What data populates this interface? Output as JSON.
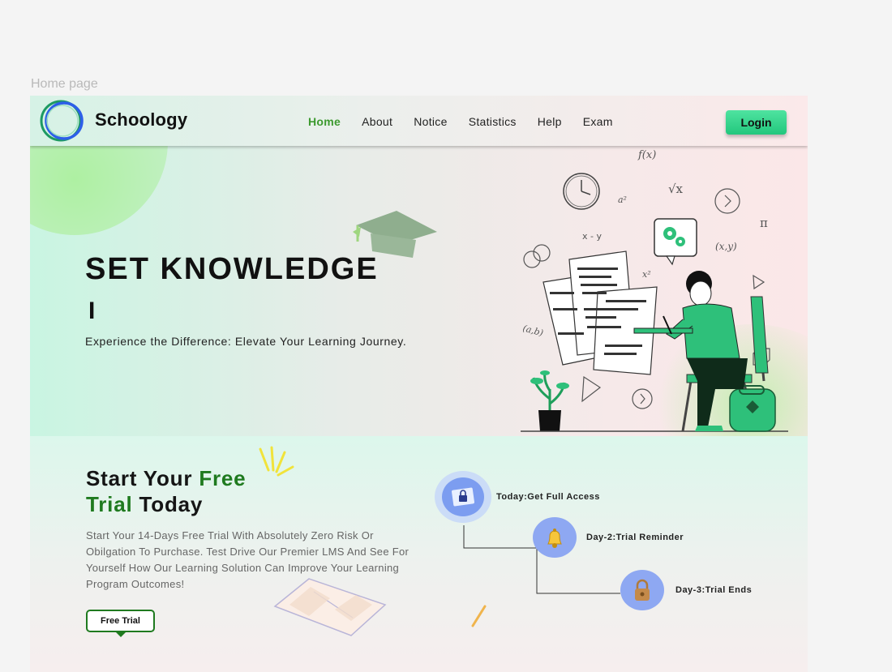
{
  "canvas": {
    "label": "Home page"
  },
  "header": {
    "brand": "Schoology",
    "nav": [
      "Home",
      "About",
      "Notice",
      "Statistics",
      "Help",
      "Exam"
    ],
    "active_nav": "Home",
    "login_label": "Login"
  },
  "hero": {
    "title": "SET KNOWLEDGE",
    "cursor": "I",
    "subtitle": "Experience the Difference: Elevate Your Learning Journey.",
    "illustration_formulas": [
      "f(x)",
      "√x",
      "a²",
      "x - y",
      "π",
      "x²",
      "(x,y)",
      "(a,b)"
    ]
  },
  "trial": {
    "title_part1": "Start Your ",
    "title_green1": "Free",
    "title_green2": "Trial",
    "title_part2": " Today",
    "description": "Start Your 14-Days Free Trial With Absolutely Zero Risk Or Obilgation To Purchase. Test Drive Our Premier LMS And See For Yourself How Our Learning Solution Can Improve Your Learning Program Outcomes!",
    "button_label": "Free Trial",
    "steps": [
      {
        "label": "Today:Get Full Access",
        "icon": "lock-icon"
      },
      {
        "label": "Day-2:Trial Reminder",
        "icon": "bell-icon"
      },
      {
        "label": "Day-3:Trial Ends",
        "icon": "padlock-icon"
      }
    ]
  },
  "colors": {
    "brand_green": "#1f7a1f",
    "active_nav": "#3c9a2f",
    "login_button": "#2fd68a"
  }
}
